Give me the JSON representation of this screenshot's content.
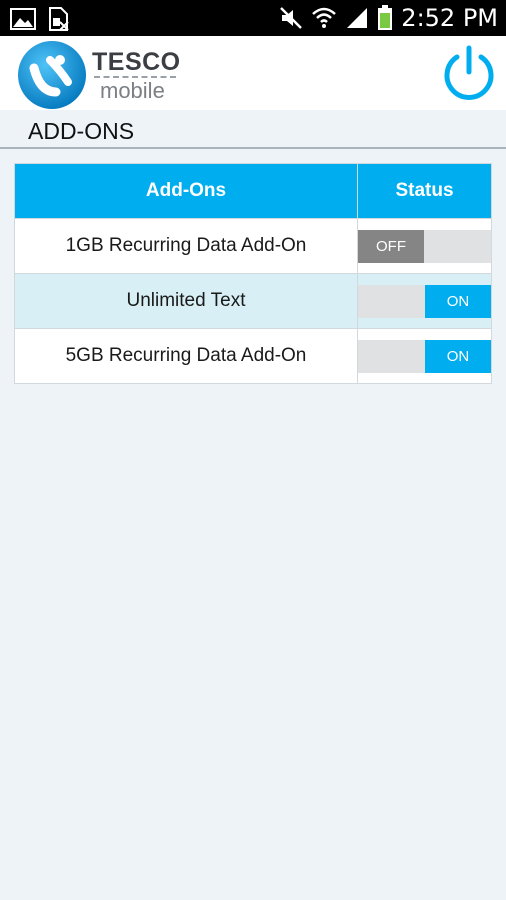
{
  "status_bar": {
    "time": "2:52 PM",
    "icons": [
      "gallery-icon",
      "sim-icon",
      "mute-icon",
      "wifi-icon",
      "signal-icon",
      "battery-icon"
    ]
  },
  "header": {
    "brand_top": "TESCO",
    "brand_bottom": "mobile",
    "accent_color": "#00aeef"
  },
  "section": {
    "title": "ADD-ONS"
  },
  "table": {
    "headers": [
      "Add-Ons",
      "Status"
    ],
    "rows": [
      {
        "name": "1GB Recurring Data Add-On",
        "status": "OFF"
      },
      {
        "name": "Unlimited Text",
        "status": "ON"
      },
      {
        "name": "5GB Recurring Data Add-On",
        "status": "ON"
      }
    ]
  }
}
